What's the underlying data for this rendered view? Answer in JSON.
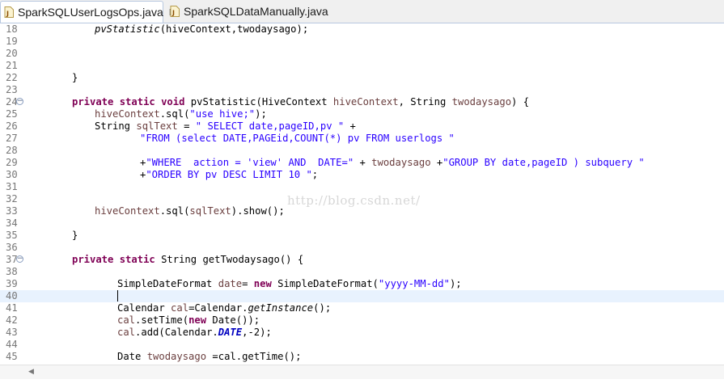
{
  "tabs": [
    {
      "label": "SparkSQLUserLogsOps.java",
      "close": "☒"
    },
    {
      "label": "SparkSQLDataManually.java"
    }
  ],
  "watermark": "http://blog.csdn.net/",
  "colors": {
    "keyword": "#7f0055",
    "string": "#2a00ff",
    "field": "#0000c0",
    "local_var": "#6a3e3e",
    "current_line": "#e8f2fe",
    "line_number": "#787878"
  },
  "lines": [
    {
      "n": "18",
      "segs": [
        {
          "c": "pvStatistic",
          "t": "i"
        },
        {
          "c": "(hiveContext,twodaysago);"
        }
      ]
    },
    {
      "n": "19",
      "segs": []
    },
    {
      "n": "20",
      "segs": []
    },
    {
      "n": "21",
      "segs": []
    },
    {
      "n": "22",
      "segs": [
        {
          "c": "}"
        }
      ]
    },
    {
      "n": "23",
      "segs": []
    },
    {
      "n": "24",
      "fold": true,
      "segs": [
        {
          "c": "private",
          "t": "k"
        },
        {
          "c": " "
        },
        {
          "c": "static",
          "t": "k"
        },
        {
          "c": " "
        },
        {
          "c": "void",
          "t": "k"
        },
        {
          "c": " pvStatistic(HiveContext "
        },
        {
          "c": "hiveContext",
          "t": "v"
        },
        {
          "c": ", String "
        },
        {
          "c": "twodaysago",
          "t": "v"
        },
        {
          "c": ") {"
        }
      ]
    },
    {
      "n": "25",
      "segs": [
        {
          "c": "hiveContext",
          "t": "v"
        },
        {
          "c": ".sql("
        },
        {
          "c": "\"use hive;\"",
          "t": "s"
        },
        {
          "c": ");"
        }
      ]
    },
    {
      "n": "26",
      "segs": [
        {
          "c": "String "
        },
        {
          "c": "sqlText",
          "t": "v"
        },
        {
          "c": " = "
        },
        {
          "c": "\" SELECT date,pageID,pv \"",
          "t": "s"
        },
        {
          "c": " +"
        }
      ]
    },
    {
      "n": "27",
      "segs": [
        {
          "c": "\"FROM (select DATE,PAGEid,COUNT(*) pv FROM userlogs \"",
          "t": "s"
        }
      ]
    },
    {
      "n": "28",
      "segs": []
    },
    {
      "n": "29",
      "segs": [
        {
          "c": "+"
        },
        {
          "c": "\"WHERE  action = 'view' AND  DATE=\"",
          "t": "s"
        },
        {
          "c": " + "
        },
        {
          "c": "twodaysago",
          "t": "v"
        },
        {
          "c": " +"
        },
        {
          "c": "\"GROUP BY date,pageID ) subquery \"",
          "t": "s"
        }
      ]
    },
    {
      "n": "30",
      "segs": [
        {
          "c": "+"
        },
        {
          "c": "\"ORDER BY pv DESC LIMIT 10 \"",
          "t": "s"
        },
        {
          "c": ";"
        }
      ]
    },
    {
      "n": "31",
      "segs": []
    },
    {
      "n": "32",
      "segs": []
    },
    {
      "n": "33",
      "segs": [
        {
          "c": "hiveContext",
          "t": "v"
        },
        {
          "c": ".sql("
        },
        {
          "c": "sqlText",
          "t": "v"
        },
        {
          "c": ").show();"
        }
      ]
    },
    {
      "n": "34",
      "segs": []
    },
    {
      "n": "35",
      "segs": [
        {
          "c": "}"
        }
      ]
    },
    {
      "n": "36",
      "segs": []
    },
    {
      "n": "37",
      "fold": true,
      "segs": [
        {
          "c": "private",
          "t": "k"
        },
        {
          "c": " "
        },
        {
          "c": "static",
          "t": "k"
        },
        {
          "c": " String getTwodaysago() {"
        }
      ]
    },
    {
      "n": "38",
      "segs": []
    },
    {
      "n": "39",
      "segs": [
        {
          "c": "SimpleDateFormat "
        },
        {
          "c": "date",
          "t": "v"
        },
        {
          "c": "= "
        },
        {
          "c": "new",
          "t": "k"
        },
        {
          "c": " SimpleDateFormat("
        },
        {
          "c": "\"yyyy-MM-dd\"",
          "t": "s"
        },
        {
          "c": ");"
        }
      ]
    },
    {
      "n": "40",
      "current": true,
      "caret": true,
      "segs": []
    },
    {
      "n": "41",
      "segs": [
        {
          "c": "Calendar "
        },
        {
          "c": "cal",
          "t": "v"
        },
        {
          "c": "=Calendar."
        },
        {
          "c": "getInstance",
          "t": "i"
        },
        {
          "c": "();"
        }
      ]
    },
    {
      "n": "42",
      "segs": [
        {
          "c": "cal",
          "t": "v"
        },
        {
          "c": ".setTime("
        },
        {
          "c": "new",
          "t": "k"
        },
        {
          "c": " Date());"
        }
      ]
    },
    {
      "n": "43",
      "segs": [
        {
          "c": "cal",
          "t": "v"
        },
        {
          "c": ".add(Calendar."
        },
        {
          "c": "DATE",
          "t": "fi"
        },
        {
          "c": ",-2);"
        }
      ]
    },
    {
      "n": "44",
      "segs": []
    },
    {
      "n": "45",
      "segs": [
        {
          "c": "Date "
        },
        {
          "c": "twodaysago",
          "t": "v"
        },
        {
          "c": " =cal.getTime();"
        }
      ]
    }
  ]
}
